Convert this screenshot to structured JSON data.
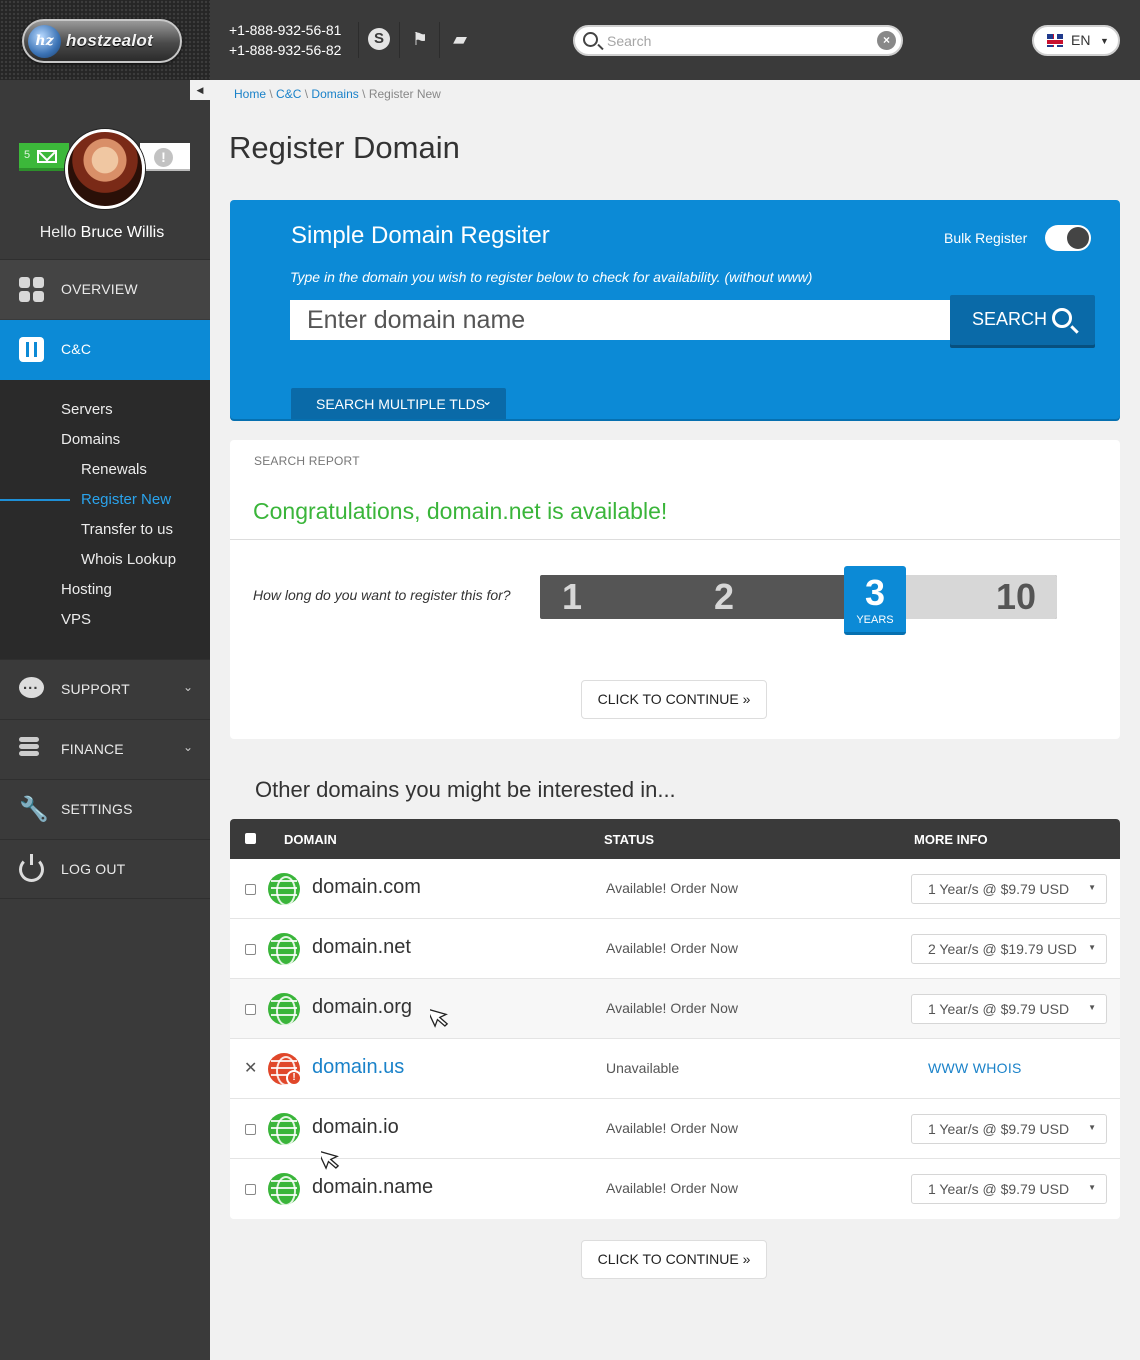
{
  "brand": {
    "logo_text": "hostzealot",
    "logo_mark": "hz"
  },
  "header": {
    "phones": [
      "+1-888-932-56-81",
      "+1-888-932-56-82"
    ],
    "icons": [
      "skype-icon",
      "flag-icon",
      "chat-icon"
    ],
    "search_placeholder": "Search",
    "language": "EN"
  },
  "profile": {
    "mail_count": "5",
    "alert_symbol": "!",
    "greeting": "Hello",
    "name": "Bruce Willis"
  },
  "nav": {
    "overview": "OVERVIEW",
    "cc": "C&C",
    "sub_items": [
      "Servers",
      "Domains",
      "Renewals",
      "Register New",
      "Transfer to us",
      "Whois Lookup",
      "Hosting",
      "VPS"
    ],
    "support": "SUPPORT",
    "finance": "FINANCE",
    "settings": "SETTINGS",
    "logout": "LOG OUT"
  },
  "breadcrumb": {
    "home": "Home",
    "cc": "C&C",
    "domains": "Domains",
    "current": "Register New",
    "separator": "\\"
  },
  "page_title": "Register Domain",
  "register": {
    "title": "Simple Domain Regsiter",
    "subtitle": "Type in the domain you wish to register below to check for availability. (without www)",
    "bulk_label": "Bulk Register",
    "input_placeholder": "Enter domain name",
    "search_label": "SEARCH",
    "multi_label": "SEARCH MULTIPLE TLDS"
  },
  "report": {
    "heading": "SEARCH REPORT",
    "message": "Congratulations, domain.net is available!",
    "question": "How long do you want to register this for?",
    "year_options": [
      "1",
      "2",
      "3",
      "10"
    ],
    "selected_year": "3",
    "years_unit": "YEARS",
    "continue_label": "CLICK TO CONTINUE »"
  },
  "other": {
    "title": "Other domains you might be interested in...",
    "columns": {
      "domain": "DOMAIN",
      "status": "STATUS",
      "more_info": "MORE INFO"
    },
    "rows": [
      {
        "name": "domain.com",
        "status": "Available! Order Now",
        "price": "1 Year/s @ $9.79 USD"
      },
      {
        "name": "domain.net",
        "status": "Available! Order Now",
        "price": "2 Year/s @ $19.79 USD"
      },
      {
        "name": "domain.org",
        "status": "Available! Order Now",
        "price": "1 Year/s @ $9.79 USD"
      },
      {
        "name": "domain.us",
        "status": "Unavailable",
        "whois": "WWW WHOIS"
      },
      {
        "name": "domain.io",
        "status": "Available! Order Now",
        "price": "1 Year/s @ $9.79 USD"
      },
      {
        "name": "domain.name",
        "status": "Available! Order Now",
        "price": "1 Year/s @ $9.79 USD"
      }
    ],
    "continue_label": "CLICK TO CONTINUE »"
  },
  "colors": {
    "accent": "#0c8ad6",
    "success": "#3ab53a",
    "danger": "#e0472a",
    "sidebar": "#3a3a3a"
  }
}
